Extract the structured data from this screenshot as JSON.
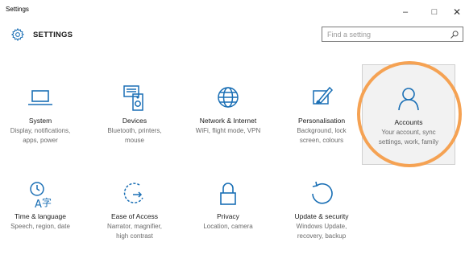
{
  "window": {
    "title": "Settings",
    "minimize": "–",
    "maximize": "□",
    "close": "✕"
  },
  "header": {
    "title": "SETTINGS",
    "search_placeholder": "Find a setting"
  },
  "tiles": [
    {
      "name": "System",
      "desc": "Display, notifications,\napps, power",
      "icon": "laptop-icon"
    },
    {
      "name": "Devices",
      "desc": "Bluetooth, printers,\nmouse",
      "icon": "devices-icon"
    },
    {
      "name": "Network & Internet",
      "desc": "WiFi, flight mode, VPN",
      "icon": "globe-icon"
    },
    {
      "name": "Personalisation",
      "desc": "Background, lock\nscreen, colours",
      "icon": "paintbrush-icon"
    },
    {
      "name": "Accounts",
      "desc": "Your account, sync\nsettings, work, family",
      "icon": "person-icon"
    },
    {
      "name": "Time & language",
      "desc": "Speech, region, date",
      "icon": "time-language-icon"
    },
    {
      "name": "Ease of Access",
      "desc": "Narrator, magnifier,\nhigh contrast",
      "icon": "ease-of-access-icon"
    },
    {
      "name": "Privacy",
      "desc": "Location, camera",
      "icon": "lock-icon"
    },
    {
      "name": "Update & security",
      "desc": "Windows Update,\nrecovery, backup",
      "icon": "refresh-icon"
    }
  ],
  "colors": {
    "accent": "#1a6fb5",
    "highlight": "#f5a253",
    "text_secondary": "#6b6b6b"
  }
}
